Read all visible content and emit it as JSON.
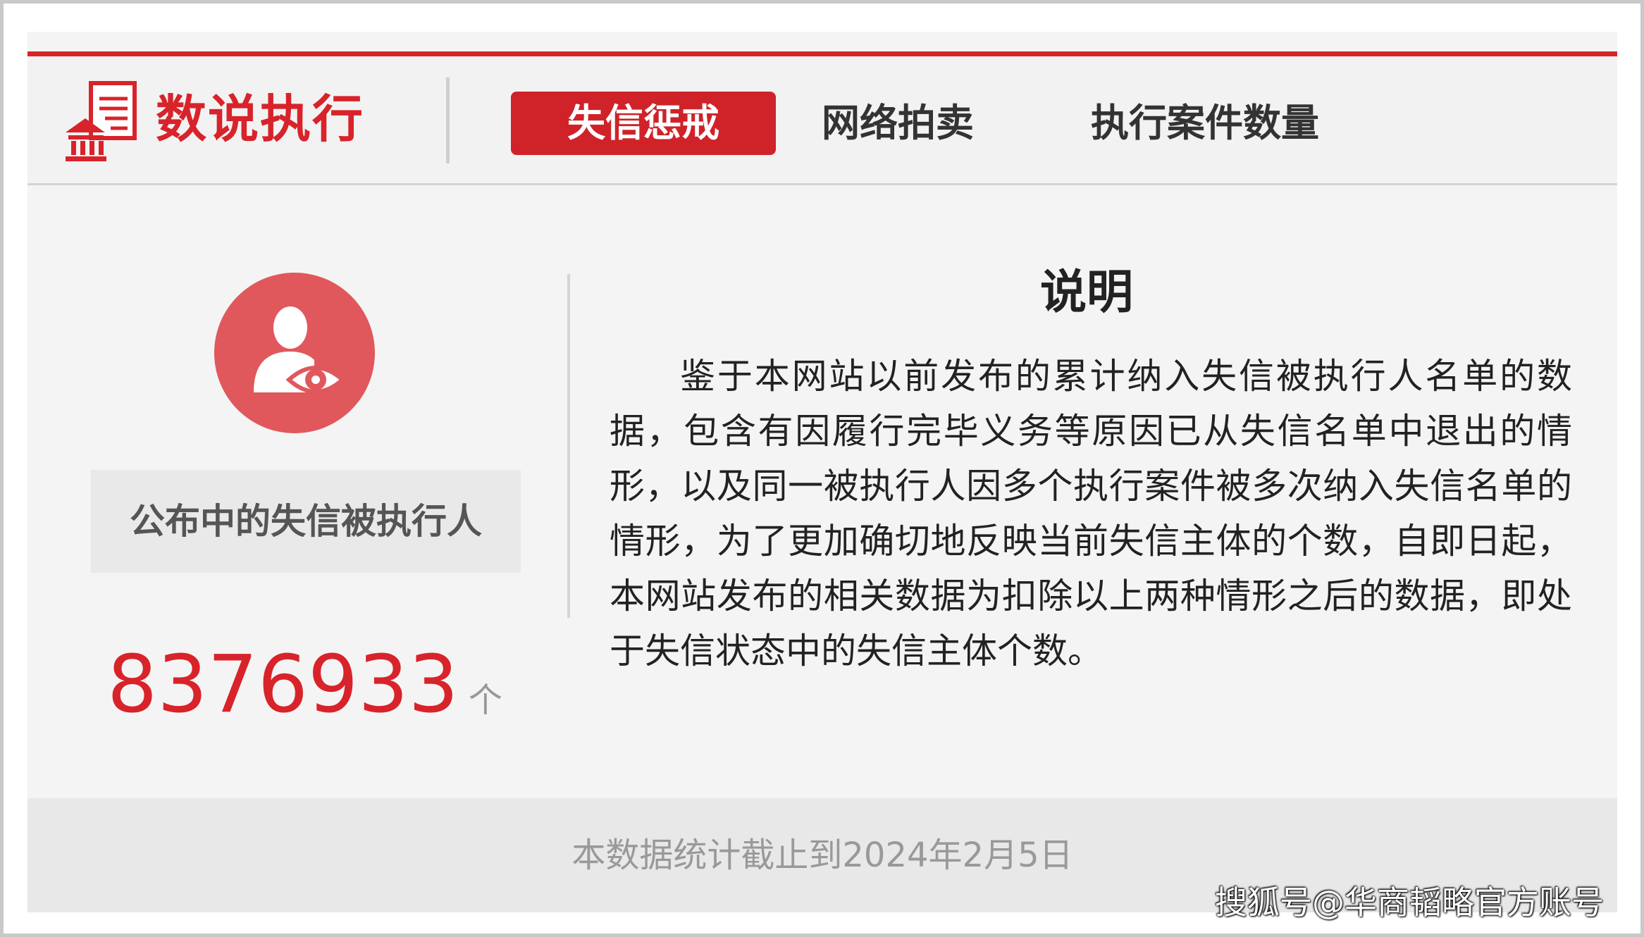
{
  "header": {
    "logo_text": "数说执行",
    "tabs": [
      {
        "label": "失信惩戒",
        "active": true
      },
      {
        "label": "网络拍卖",
        "active": false
      },
      {
        "label": "执行案件数量",
        "active": false
      }
    ]
  },
  "stats": {
    "label": "公布中的失信被执行人",
    "count": "8376933",
    "unit": "个"
  },
  "note": {
    "title": "说明",
    "body": "鉴于本网站以前发布的累计纳入失信被执行人名单的数据，包含有因履行完毕义务等原因已从失信名单中退出的情形，以及同一被执行人因多个执行案件被多次纳入失信名单的情形，为了更加确切地反映当前失信主体的个数，自即日起，本网站发布的相关数据为扣除以上两种情形之后的数据，即处于失信状态中的失信主体个数。"
  },
  "footer": {
    "text": "本数据统计截止到2024年2月5日"
  },
  "watermark": "搜狐号@华商韬略官方账号",
  "colors": {
    "accent": "#d8232a",
    "avatar": "#e0585c",
    "panel": "#f4f4f4"
  },
  "icons": {
    "logo": "court-document-icon",
    "avatar": "person-eye-icon"
  }
}
